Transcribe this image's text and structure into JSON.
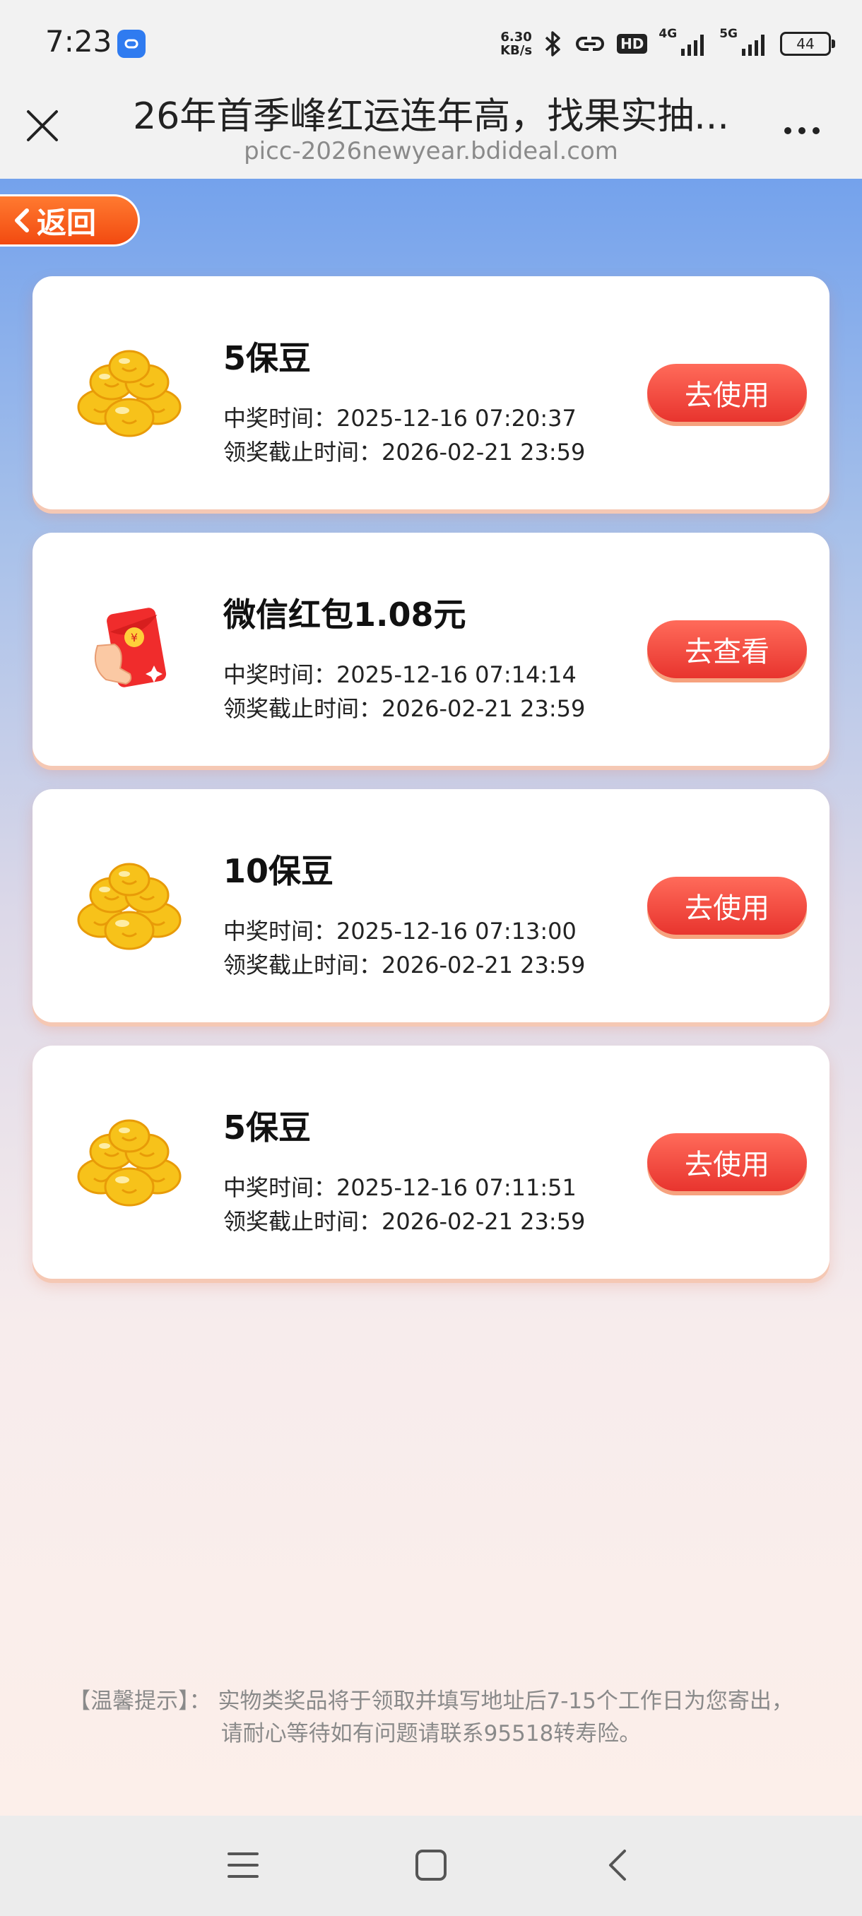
{
  "status_bar": {
    "time": "7:23",
    "net_speed_value": "6.30",
    "net_speed_unit": "KB/s",
    "hd_label": "HD",
    "signal1_label": "4G",
    "signal2_label": "5G",
    "battery": "44"
  },
  "title_bar": {
    "title": "26年首季峰红运连年高，找果实抽...",
    "url": "picc-2026newyear.bdideal.com"
  },
  "back_button_label": "返回",
  "labels": {
    "win_time_prefix": "中奖时间：",
    "deadline_prefix": "领奖截止时间："
  },
  "prizes": [
    {
      "name": "5保豆",
      "icon": "gold-beans-icon",
      "win_time": "2025-12-16 07:20:37",
      "deadline": "2026-02-21 23:59",
      "action": "去使用"
    },
    {
      "name": "微信红包1.08元",
      "icon": "red-envelope-icon",
      "win_time": "2025-12-16 07:14:14",
      "deadline": "2026-02-21 23:59",
      "action": "去查看"
    },
    {
      "name": "10保豆",
      "icon": "gold-beans-icon",
      "win_time": "2025-12-16 07:13:00",
      "deadline": "2026-02-21 23:59",
      "action": "去使用"
    },
    {
      "name": "5保豆",
      "icon": "gold-beans-icon",
      "win_time": "2025-12-16 07:11:51",
      "deadline": "2026-02-21 23:59",
      "action": "去使用"
    }
  ],
  "footer": {
    "line1": "【温馨提示】： 实物类奖品将于领取并填写地址后7-15个工作日为您寄出，",
    "line2": "请耐心等待如有问题请联系95518转寿险。"
  },
  "colors": {
    "accent": "#e8342e",
    "back_button": "#f24a10",
    "background_top": "#74a2ec",
    "background_bottom": "#fcefea"
  }
}
